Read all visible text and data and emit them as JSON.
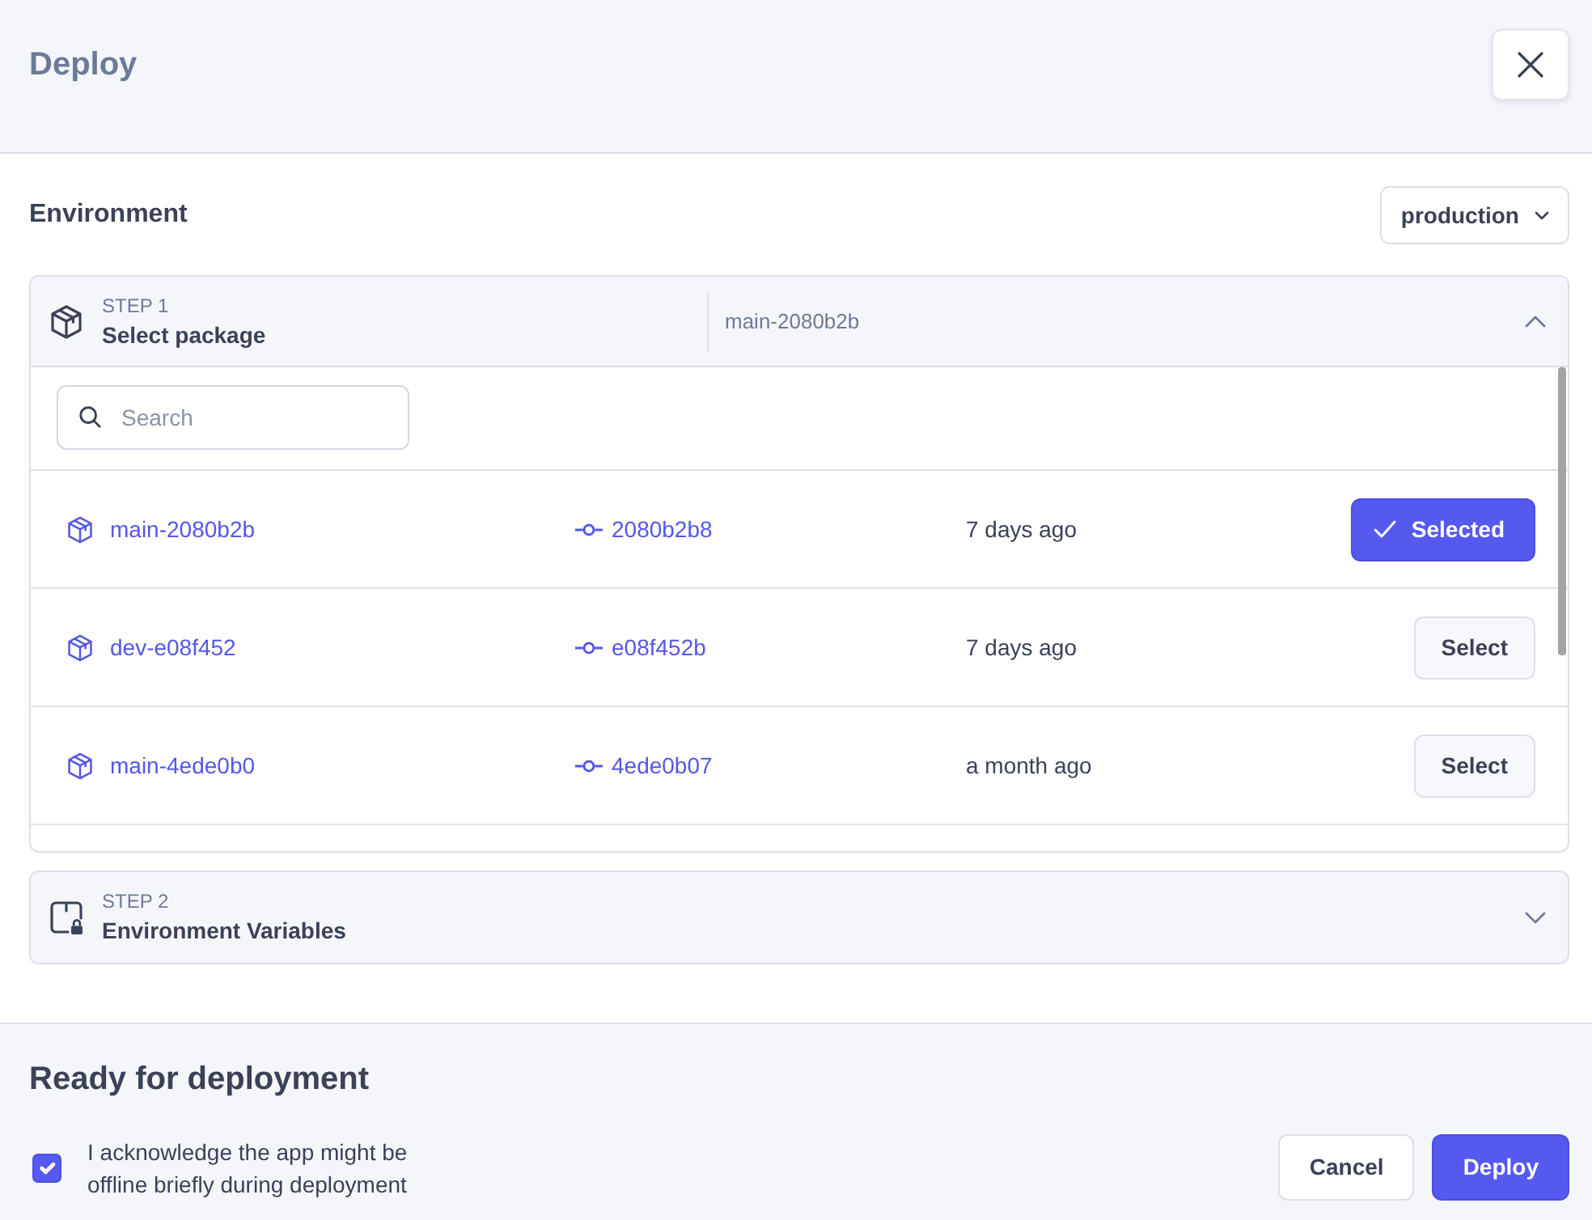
{
  "dialog": {
    "title": "Deploy"
  },
  "environment": {
    "label": "Environment",
    "value": "production"
  },
  "steps": [
    {
      "step": "STEP 1",
      "title": "Select package",
      "summary": "main-2080b2b",
      "expanded": true,
      "search": {
        "placeholder": "Search"
      },
      "packages": [
        {
          "name": "main-2080b2b",
          "commit": "2080b2b8",
          "age": "7 days ago",
          "selected": true,
          "button": "Selected"
        },
        {
          "name": "dev-e08f452",
          "commit": "e08f452b",
          "age": "7 days ago",
          "selected": false,
          "button": "Select"
        },
        {
          "name": "main-4ede0b0",
          "commit": "4ede0b07",
          "age": "a month ago",
          "selected": false,
          "button": "Select"
        }
      ]
    },
    {
      "step": "STEP 2",
      "title": "Environment Variables",
      "expanded": false
    }
  ],
  "footer": {
    "title": "Ready for deployment",
    "acknowledge": {
      "text": "I acknowledge the app might be offline briefly during deployment",
      "checked": true
    },
    "buttons": [
      {
        "label": "Cancel",
        "kind": "secondary"
      },
      {
        "label": "Deploy",
        "kind": "primary"
      }
    ]
  }
}
